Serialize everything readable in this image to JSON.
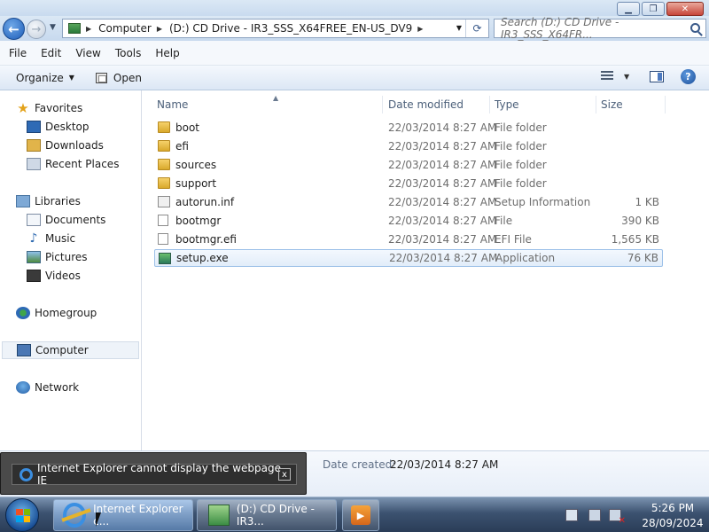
{
  "address": {
    "crumbs": [
      "Computer",
      "(D:) CD Drive - IR3_SSS_X64FREE_EN-US_DV9"
    ],
    "search_placeholder": "Search (D:) CD Drive - IR3_SSS_X64FR..."
  },
  "menu": [
    "File",
    "Edit",
    "View",
    "Tools",
    "Help"
  ],
  "commands": {
    "organize": "Organize",
    "open": "Open"
  },
  "nav": {
    "favorites": "Favorites",
    "desktop": "Desktop",
    "downloads": "Downloads",
    "recent": "Recent Places",
    "libraries": "Libraries",
    "documents": "Documents",
    "music": "Music",
    "pictures": "Pictures",
    "videos": "Videos",
    "homegroup": "Homegroup",
    "computer": "Computer",
    "network": "Network"
  },
  "columns": {
    "name": "Name",
    "date": "Date modified",
    "type": "Type",
    "size": "Size"
  },
  "files": [
    {
      "name": "boot",
      "date": "22/03/2014 8:27 AM",
      "type": "File folder",
      "size": "",
      "icon": "folder-icon"
    },
    {
      "name": "efi",
      "date": "22/03/2014 8:27 AM",
      "type": "File folder",
      "size": "",
      "icon": "folder-icon"
    },
    {
      "name": "sources",
      "date": "22/03/2014 8:27 AM",
      "type": "File folder",
      "size": "",
      "icon": "folder-icon"
    },
    {
      "name": "support",
      "date": "22/03/2014 8:27 AM",
      "type": "File folder",
      "size": "",
      "icon": "folder-icon"
    },
    {
      "name": "autorun.inf",
      "date": "22/03/2014 8:27 AM",
      "type": "Setup Information",
      "size": "1 KB",
      "icon": "inf-file-icon"
    },
    {
      "name": "bootmgr",
      "date": "22/03/2014 8:27 AM",
      "type": "File",
      "size": "390 KB",
      "icon": "file-icon"
    },
    {
      "name": "bootmgr.efi",
      "date": "22/03/2014 8:27 AM",
      "type": "EFI File",
      "size": "1,565 KB",
      "icon": "file-icon"
    },
    {
      "name": "setup.exe",
      "date": "22/03/2014 8:27 AM",
      "type": "Application",
      "size": "76 KB",
      "icon": "setup-icon"
    }
  ],
  "details": {
    "label": "Date created:",
    "value": "22/03/2014 8:27 AM"
  },
  "notification": {
    "text": "Internet Explorer cannot display the webpage - IE",
    "close": "x"
  },
  "taskbar": {
    "ie_label": "Internet Explorer c...",
    "explorer_label": "(D:) CD Drive - IR3...",
    "time": "5:26 PM",
    "date": "28/09/2024"
  }
}
